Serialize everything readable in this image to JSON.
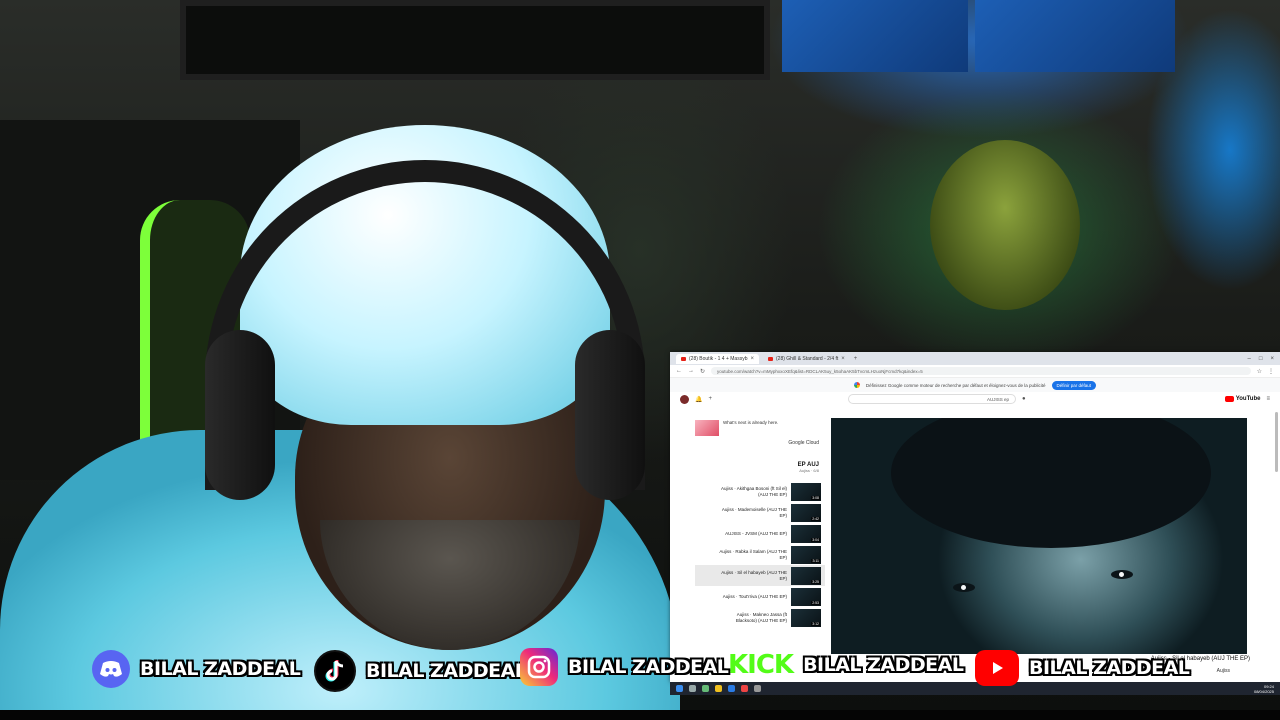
{
  "browser": {
    "tabs": [
      {
        "label": "(28) Boutik - 1 4 + Massyb"
      },
      {
        "label": "(28) Ghill & Standard - 2/4 ft"
      }
    ],
    "url": "youtube.com/watch?v=mMyphxxoXEfq&list=RDCLAK5uy_k5ohaAK5bTvcmLHzuoNjFcmd7kq&index=5",
    "infobar_text": "Définissez Google comme moteur de recherche par défaut et éloignez-vous de la publicité",
    "infobar_button": "Définir par défaut",
    "search_query": "AUJISS ep",
    "logo_text": "YouTube",
    "ad_title": "What's next is already here.",
    "ad_sponsor": "Google Cloud",
    "playlist_title": "EP AUJ",
    "playlist_meta": "Aujiss · 6/8",
    "playlist": [
      {
        "title": "Aujiss · Akithgaa Bosoni (ft Sil el) (AUJ THE EP)",
        "duration": "3:08"
      },
      {
        "title": "Aujiss · Mademoiselle (AUJ THE EP)",
        "duration": "2:42"
      },
      {
        "title": "AUJISS - JVSM (AUJ THE EP)",
        "duration": "3:04"
      },
      {
        "title": "Aujiss · Rabka il Salam (AUJ THE EP)",
        "duration": "3:11"
      },
      {
        "title": "Aujiss · Sil el habayeb (AUJ THE EP)",
        "duration": "3:25",
        "current": true
      },
      {
        "title": "Aujiss · Tout'rriva (AUJ THE EP)",
        "duration": "2:53"
      },
      {
        "title": "Aujiss · Makneo Jassa (ft Blacksoto) (AUJ THE EP)",
        "duration": "3:12"
      }
    ],
    "video_title": "Aujiss - Sil el habayeb (AUJ THE EP)",
    "channel": "Aujiss",
    "clock_time": "09:24",
    "clock_date": "08/04/2025"
  },
  "overlay": {
    "socials": [
      {
        "platform": "discord",
        "label": "BILAL ZADDEAL",
        "color": "#5865f2"
      },
      {
        "platform": "tiktok",
        "label": "BILAL ZADDEAL",
        "color": "#000000"
      },
      {
        "platform": "instagram",
        "label": "BILAL ZADDEAL",
        "color": "#e1306c"
      },
      {
        "platform": "kick",
        "label": "BILAL ZADDEAL",
        "color": "#53fc18",
        "logo_text": "KICK"
      },
      {
        "platform": "youtube",
        "label": "BILAL ZADDEAL",
        "color": "#ff0000"
      }
    ]
  }
}
